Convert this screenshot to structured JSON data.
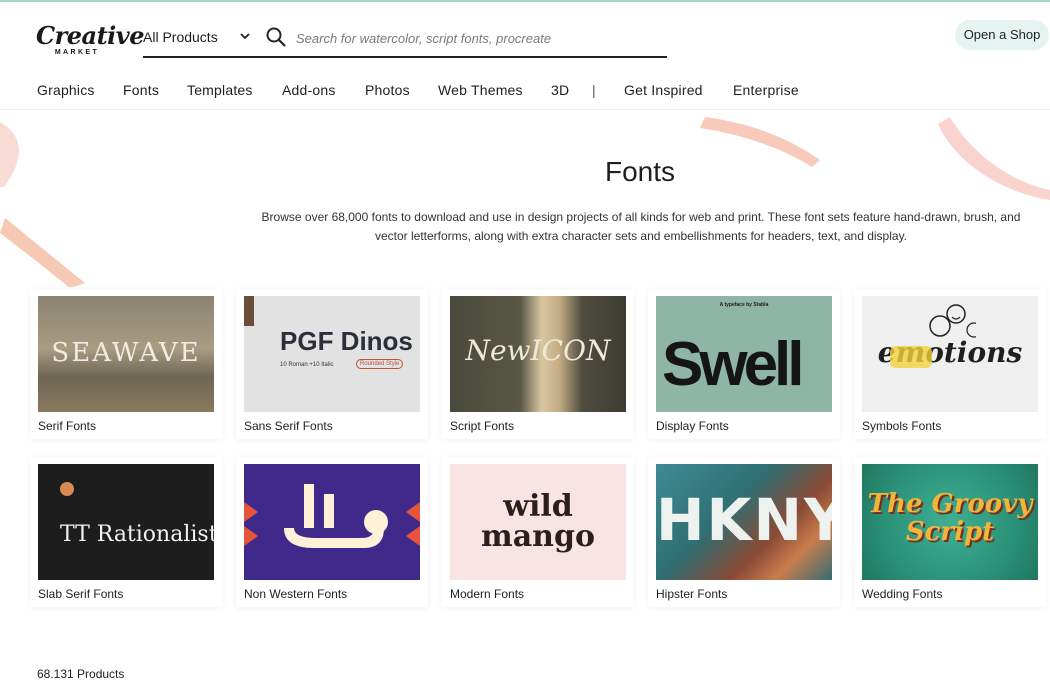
{
  "header": {
    "logo_word": "Creative",
    "logo_sub": "MARKET",
    "department": "All Products",
    "search_placeholder": "Search for watercolor, script fonts, procreate",
    "open_shop_label": "Open a Shop"
  },
  "nav": {
    "items": [
      "Graphics",
      "Fonts",
      "Templates",
      "Add-ons",
      "Photos",
      "Web Themes",
      "3D",
      "|",
      "Get Inspired",
      "Enterprise"
    ]
  },
  "hero": {
    "title": "Fonts",
    "description": "Browse over 68,000 fonts to download and use in design projects of all kinds for web and print. These font sets feature hand-drawn, brush, and vector letterforms, along with extra character sets and embellishments for headers, text, and display."
  },
  "categories": [
    {
      "label": "Serif Fonts",
      "thumb_text": "SEAWAVE"
    },
    {
      "label": "Sans Serif Fonts",
      "thumb_text": "PGF Dinos",
      "thumb_sub": "10 Roman +10 Italic",
      "thumb_badge": "Rounded Style"
    },
    {
      "label": "Script Fonts",
      "thumb_text": "NewICON"
    },
    {
      "label": "Display Fonts",
      "thumb_text": "Swell",
      "thumb_sub": "A typeface by Stabla"
    },
    {
      "label": "Symbols Fonts",
      "thumb_text": "emotions"
    },
    {
      "label": "Slab Serif Fonts",
      "thumb_text": "TT Rationalist"
    },
    {
      "label": "Non Western Fonts",
      "thumb_text": ""
    },
    {
      "label": "Modern Fonts",
      "thumb_text": "wild mango"
    },
    {
      "label": "Hipster Fonts",
      "thumb_text": "HKNY"
    },
    {
      "label": "Wedding Fonts",
      "thumb_text": "The Groovy Script"
    }
  ],
  "footer": {
    "count": "68.131 Products"
  },
  "colors": {
    "accent_mint": "#9fd8cc",
    "open_shop_bg": "#e6f4f1",
    "brush_pink": "#f5c6c0"
  }
}
